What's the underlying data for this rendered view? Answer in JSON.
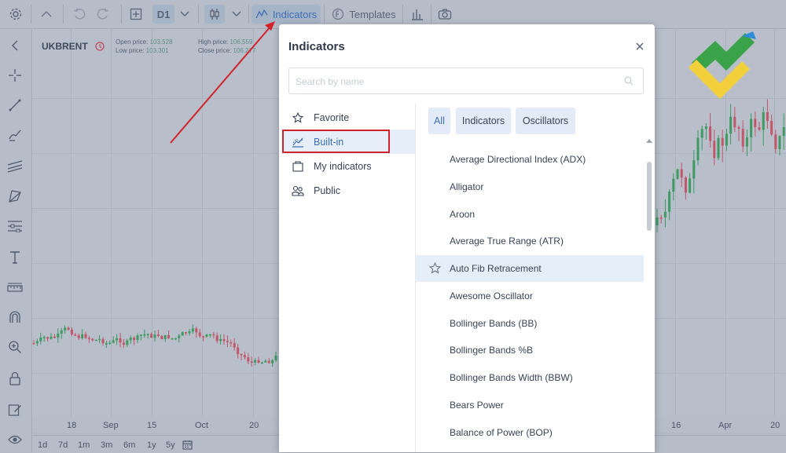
{
  "toolbar": {
    "timeframe": "D1",
    "indicators_label": "Indicators",
    "templates_label": "Templates"
  },
  "chart": {
    "symbol": "UKBRENT",
    "open_label": "Open price:",
    "open_value": "103.528",
    "high_label": "High price:",
    "high_value": "106.559",
    "low_label": "Low price:",
    "low_value": "103.301",
    "close_label": "Close price:",
    "close_value": "106.277",
    "x_labels": [
      "18",
      "Sep",
      "15",
      "Oct",
      "20",
      "16",
      "Apr",
      "20"
    ],
    "periods": [
      "1d",
      "7d",
      "1m",
      "3m",
      "6m",
      "1y",
      "5y"
    ]
  },
  "modal": {
    "title": "Indicators",
    "close_symbol": "×",
    "search_placeholder": "Search by name",
    "categories": [
      {
        "label": "Favorite",
        "icon": "star-icon"
      },
      {
        "label": "Built-in",
        "icon": "chart-line-icon"
      },
      {
        "label": "My indicators",
        "icon": "folder-icon"
      },
      {
        "label": "Public",
        "icon": "users-icon"
      }
    ],
    "filters": [
      "All",
      "Indicators",
      "Oscillators"
    ],
    "indicators": [
      "Average Directional Index (ADX)",
      "Alligator",
      "Aroon",
      "Average True Range (ATR)",
      "Auto Fib Retracement",
      "Awesome Oscillator",
      "Bollinger Bands (BB)",
      "Bollinger Bands %B",
      "Bollinger Bands Width (BBW)",
      "Bears Power",
      "Balance of Power (BOP)"
    ]
  },
  "colors": {
    "accent": "#3d6fb5",
    "highlight_box": "#d1232a",
    "arrow": "#d1232a",
    "candle_up": "#3d9a62",
    "candle_down": "#c2566a"
  }
}
